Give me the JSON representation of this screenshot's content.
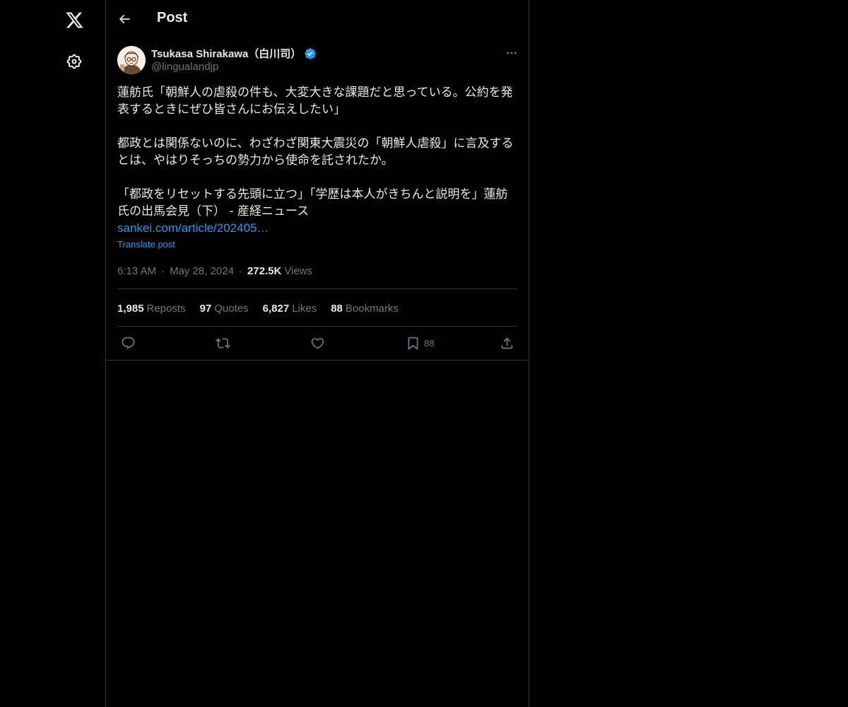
{
  "page": {
    "title": "Post"
  },
  "nav": {
    "logo_icon": "x-logo-icon",
    "settings_icon": "gear-icon"
  },
  "header": {
    "back_icon": "arrow-left-icon",
    "title": "Post"
  },
  "tweet": {
    "author": {
      "name": "Tsukasa Shirakawa（白川司）",
      "handle": "@lingualandjp",
      "verified": true
    },
    "more_icon": "more-horizontal-icon",
    "body": {
      "paragraph1": "蓮舫氏「朝鮮人の虐殺の件も、大変大きな課題だと思っている。公約を発表するときにぜひ皆さんにお伝えしたい」",
      "paragraph2": "都政とは関係ないのに、わざわざ関東大震災の「朝鮮人虐殺」に言及するとは、やはりそっちの勢力から使命を託されたか。",
      "paragraph3": "「都政をリセットする先頭に立つ」「学歴は本人がきちんと説明を」蓮舫氏の出馬会見（下） - 産経ニュース",
      "link": "sankei.com/article/202405…"
    },
    "translate_label": "Translate post",
    "meta": {
      "time": "6:13 AM",
      "separator": "·",
      "date": "May 28, 2024",
      "views_count": "272.5K",
      "views_label": "Views"
    },
    "stats": [
      {
        "count": "1,985",
        "label": "Reposts"
      },
      {
        "count": "97",
        "label": "Quotes"
      },
      {
        "count": "6,827",
        "label": "Likes"
      },
      {
        "count": "88",
        "label": "Bookmarks"
      }
    ],
    "actions": {
      "reply_icon": "reply-icon",
      "repost_icon": "repost-icon",
      "like_icon": "heart-icon",
      "bookmark_icon": "bookmark-icon",
      "bookmark_count": "88",
      "share_icon": "share-icon"
    }
  },
  "colors": {
    "background": "#000000",
    "text": "#e7e9ea",
    "secondary_text": "#71767b",
    "accent": "#1d9bf0",
    "border": "#2f3336"
  }
}
